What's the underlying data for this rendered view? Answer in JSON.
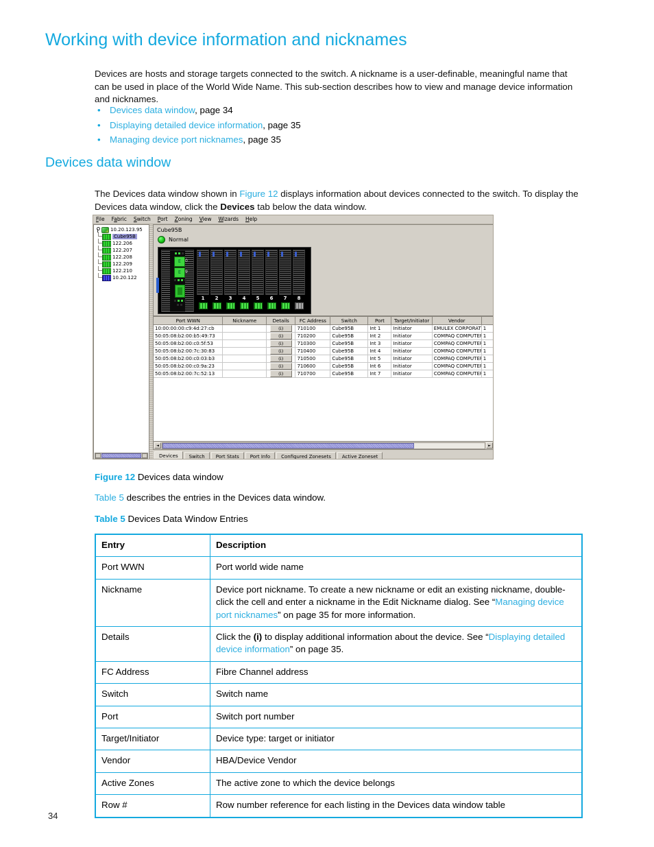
{
  "document": {
    "page_number": "34",
    "accent_color": "#14A9DF",
    "h1": "Working with device information and nicknames",
    "intro_paragraph": "Devices are hosts and storage targets connected to the switch. A nickname is a user-definable, meaningful name that can be used in place of the World Wide Name. This sub-section describes how to view and manage device information and nicknames.",
    "bullets": [
      {
        "link": "Devices data window",
        "rest": ", page 34"
      },
      {
        "link": "Displaying detailed device information",
        "rest": ", page 35"
      },
      {
        "link": "Managing device port nicknames",
        "rest": ", page 35"
      }
    ],
    "h2": "Devices data window",
    "section_paragraph": {
      "part1": "The Devices data window shown in ",
      "link": "Figure 12",
      "part2": " displays information about devices connected to the switch. To display the Devices data window, click the ",
      "bold": "Devices",
      "part3": " tab below the data window."
    },
    "figure_caption": {
      "label": "Figure 12",
      "text": "Devices data window"
    },
    "table_sentence": {
      "link": "Table 5",
      "text": " describes the entries in the Devices data window."
    },
    "table_caption": {
      "label": "Table 5",
      "text": "Devices Data Window Entries"
    }
  },
  "screenshot": {
    "menubar": [
      {
        "label": "File",
        "mnemonic": "F"
      },
      {
        "label": "Fabric",
        "mnemonic": "a"
      },
      {
        "label": "Switch",
        "mnemonic": "S"
      },
      {
        "label": "Port",
        "mnemonic": "P"
      },
      {
        "label": "Zoning",
        "mnemonic": "Z"
      },
      {
        "label": "View",
        "mnemonic": "V"
      },
      {
        "label": "Wizards",
        "mnemonic": "W"
      },
      {
        "label": "Help",
        "mnemonic": "H"
      }
    ],
    "tree": {
      "root": "10.20.123.95",
      "children": [
        {
          "label": "Cube95B",
          "selected": true,
          "icon": "switch-green-icon"
        },
        {
          "label": "122.206",
          "selected": false,
          "icon": "switch-green-icon"
        },
        {
          "label": "122.207",
          "selected": false,
          "icon": "switch-green-icon"
        },
        {
          "label": "122.208",
          "selected": false,
          "icon": "switch-green-icon"
        },
        {
          "label": "122.209",
          "selected": false,
          "icon": "switch-green-icon"
        },
        {
          "label": "122.210",
          "selected": false,
          "icon": "switch-green-icon"
        },
        {
          "label": "10.20.122",
          "selected": false,
          "icon": "switch-blue-icon"
        }
      ]
    },
    "faceplate": {
      "title": "Cube95B",
      "status": "Normal",
      "status_color": "#18c618",
      "cpu_leds": [
        "E",
        "E"
      ],
      "cpu_led_numbers": [
        "0",
        "9"
      ],
      "ports": [
        {
          "number": "1",
          "led": "on"
        },
        {
          "number": "2",
          "led": "on"
        },
        {
          "number": "3",
          "led": "on"
        },
        {
          "number": "4",
          "led": "on"
        },
        {
          "number": "5",
          "led": "on"
        },
        {
          "number": "6",
          "led": "on"
        },
        {
          "number": "7",
          "led": "on"
        },
        {
          "number": "8",
          "led": "off"
        }
      ]
    },
    "data_window": {
      "columns": [
        "Port WWN",
        "Nickname",
        "Details",
        "FC Address",
        "Switch",
        "Port",
        "Target/Initiator",
        "Vendor",
        ""
      ],
      "details_button_label": "(i)",
      "rows": [
        {
          "port_wwn": "10:00:00:00:c9:4d:27:cb",
          "nickname": "",
          "fc_address": "710100",
          "switch": "Cube95B",
          "port": "Int 1",
          "target_initiator": "Initiator",
          "vendor": "EMULEX CORPORATION",
          "extra": "1"
        },
        {
          "port_wwn": "50:05:08:b2:00:b5:49:73",
          "nickname": "",
          "fc_address": "710200",
          "switch": "Cube95B",
          "port": "Int 2",
          "target_initiator": "Initiator",
          "vendor": "COMPAQ COMPUTER C...",
          "extra": "1"
        },
        {
          "port_wwn": "50:05:08:b2:00:c0:5f:53",
          "nickname": "",
          "fc_address": "710300",
          "switch": "Cube95B",
          "port": "Int 3",
          "target_initiator": "Initiator",
          "vendor": "COMPAQ COMPUTER C...",
          "extra": "1"
        },
        {
          "port_wwn": "50:05:08:b2:00:7c:30:83",
          "nickname": "",
          "fc_address": "710400",
          "switch": "Cube95B",
          "port": "Int 4",
          "target_initiator": "Initiator",
          "vendor": "COMPAQ COMPUTER C...",
          "extra": "1"
        },
        {
          "port_wwn": "50:05:08:b2:00:c0:03:b3",
          "nickname": "",
          "fc_address": "710500",
          "switch": "Cube95B",
          "port": "Int 5",
          "target_initiator": "Initiator",
          "vendor": "COMPAQ COMPUTER C...",
          "extra": "1"
        },
        {
          "port_wwn": "50:05:08:b2:00:c0:9a:23",
          "nickname": "",
          "fc_address": "710600",
          "switch": "Cube95B",
          "port": "Int 6",
          "target_initiator": "Initiator",
          "vendor": "COMPAQ COMPUTER C...",
          "extra": "1"
        },
        {
          "port_wwn": "50:05:08:b2:00:7c:52:13",
          "nickname": "",
          "fc_address": "710700",
          "switch": "Cube95B",
          "port": "Int 7",
          "target_initiator": "Initiator",
          "vendor": "COMPAQ COMPUTER C...",
          "extra": "1"
        }
      ]
    },
    "tabs": [
      {
        "label": "Devices",
        "active": true
      },
      {
        "label": "Switch",
        "active": false
      },
      {
        "label": "Port Stats",
        "active": false
      },
      {
        "label": "Port Info",
        "active": false
      },
      {
        "label": "Configured Zonesets",
        "active": false
      },
      {
        "label": "Active Zoneset",
        "active": false
      }
    ]
  },
  "entries_table": {
    "headers": [
      "Entry",
      "Description"
    ],
    "rows": [
      {
        "entry": "Port WWN",
        "description_parts": [
          {
            "t": "Port world wide name"
          }
        ]
      },
      {
        "entry": "Nickname",
        "description_parts": [
          {
            "t": "Device port nickname. To create a new nickname or edit an existing nickname, double-click the cell and enter a nickname in the Edit Nickname dialog. See “"
          },
          {
            "t": "Managing device port nicknames",
            "link": true
          },
          {
            "t": "” on page 35 for more information."
          }
        ]
      },
      {
        "entry": "Details",
        "description_parts": [
          {
            "t": "Click the "
          },
          {
            "t": "(i)",
            "bold": true
          },
          {
            "t": " to display additional information about the device. See “"
          },
          {
            "t": "Displaying detailed device information",
            "link": true
          },
          {
            "t": "” on page 35."
          }
        ]
      },
      {
        "entry": "FC Address",
        "description_parts": [
          {
            "t": "Fibre Channel address"
          }
        ]
      },
      {
        "entry": "Switch",
        "description_parts": [
          {
            "t": "Switch name"
          }
        ]
      },
      {
        "entry": "Port",
        "description_parts": [
          {
            "t": "Switch port number"
          }
        ]
      },
      {
        "entry": "Target/Initiator",
        "description_parts": [
          {
            "t": "Device type: target or initiator"
          }
        ]
      },
      {
        "entry": "Vendor",
        "description_parts": [
          {
            "t": "HBA/Device Vendor"
          }
        ]
      },
      {
        "entry": "Active Zones",
        "description_parts": [
          {
            "t": "The active zone to which the device belongs"
          }
        ]
      },
      {
        "entry": "Row #",
        "description_parts": [
          {
            "t": "Row number reference for each listing in the Devices data window table"
          }
        ]
      }
    ]
  }
}
